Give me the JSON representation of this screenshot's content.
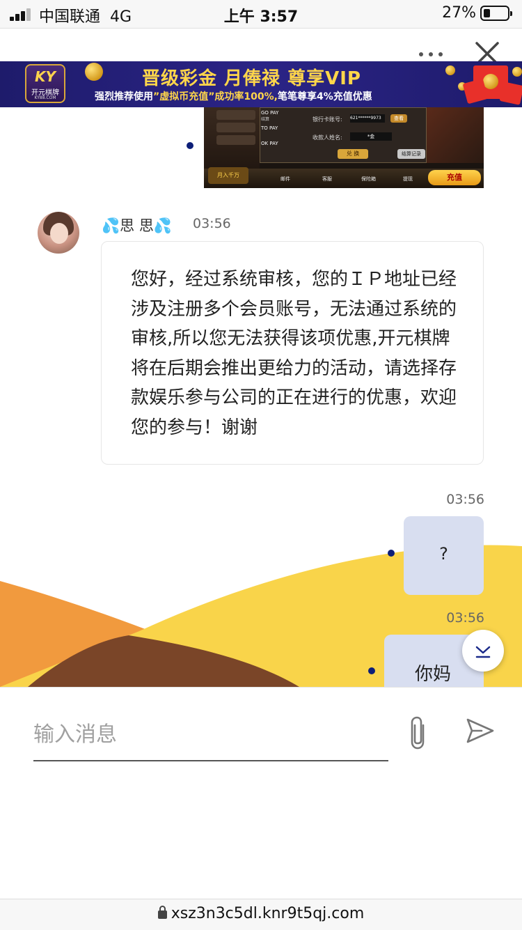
{
  "status_bar": {
    "carrier": "中国联通",
    "network": "4G",
    "time": "上午 3:57",
    "battery_percent": "27%"
  },
  "toolbar": {
    "more_icon": "more-horizontal-icon",
    "close_icon": "close-icon"
  },
  "banner": {
    "logo_text": "KY",
    "logo_name": "开元棋牌",
    "logo_site": "KY88.COM",
    "title": "晋级彩金 月俸禄 尊享VIP",
    "subtitle_prefix": "强烈推荐使用",
    "subtitle_highlight": "”虚拟币充值”成功率100%,",
    "subtitle_suffix": "笔笔尊享4%充值优惠"
  },
  "game_screenshot": {
    "bank_label": "银行卡账号:",
    "bank_value": "621******9973",
    "query_btn": "查看",
    "name_label": "收款人姓名:",
    "name_value": "*金",
    "exchange_btn": "兑 换",
    "records_btn": "结算记录",
    "pay1": "GO PAY",
    "pay2": "TO PAY",
    "pay3": "OK PAY",
    "pay_note": "结算",
    "nav": [
      "邮件",
      "客服",
      "保险箱",
      "提现"
    ],
    "recharge": "充值",
    "promo": "月入千万"
  },
  "messages": [
    {
      "sender": "💦思 思💦",
      "time": "03:56",
      "text": "您好，经过系统审核，您的ＩＰ地址已经涉及注册多个会员账号，无法通过系统的审核,所以您无法获得该项优惠,开元棋牌 将在后期会推出更给力的活动，请选择存款娱乐参与公司的正在进行的优惠，欢迎您的参与！谢谢"
    },
    {
      "time": "03:56",
      "text": "?"
    },
    {
      "time": "03:56",
      "text": "你妈"
    }
  ],
  "input": {
    "placeholder": "输入消息"
  },
  "url_bar": {
    "url": "xsz3n3c5dl.knr9t5qj.com"
  },
  "colors": {
    "banner_bg": "#1e1b6b",
    "banner_title": "#ffd64a",
    "user_bubble": "#d8def0",
    "read_dot": "#0d1f78",
    "wave_yellow": "#f9d44a",
    "wave_orange": "#f19a3e",
    "wave_brown": "#7a4528"
  }
}
